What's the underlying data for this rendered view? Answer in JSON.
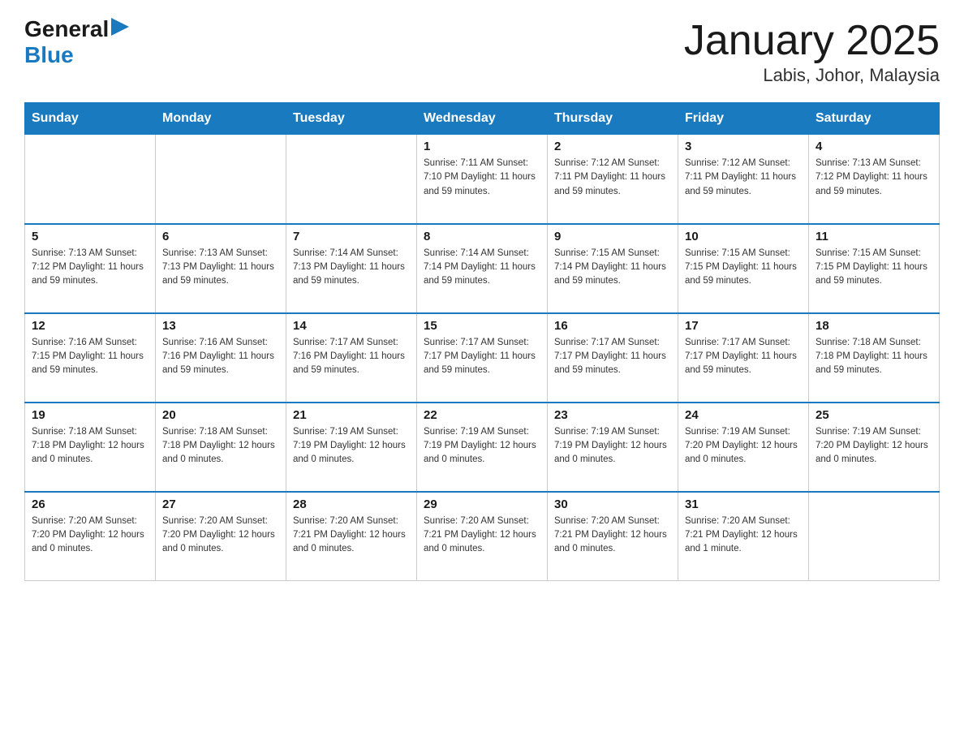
{
  "header": {
    "logo": {
      "general": "General",
      "blue": "Blue",
      "arrow": "▶"
    },
    "title": "January 2025",
    "subtitle": "Labis, Johor, Malaysia"
  },
  "days_of_week": [
    "Sunday",
    "Monday",
    "Tuesday",
    "Wednesday",
    "Thursday",
    "Friday",
    "Saturday"
  ],
  "weeks": [
    [
      {
        "day": "",
        "info": ""
      },
      {
        "day": "",
        "info": ""
      },
      {
        "day": "",
        "info": ""
      },
      {
        "day": "1",
        "info": "Sunrise: 7:11 AM\nSunset: 7:10 PM\nDaylight: 11 hours\nand 59 minutes."
      },
      {
        "day": "2",
        "info": "Sunrise: 7:12 AM\nSunset: 7:11 PM\nDaylight: 11 hours\nand 59 minutes."
      },
      {
        "day": "3",
        "info": "Sunrise: 7:12 AM\nSunset: 7:11 PM\nDaylight: 11 hours\nand 59 minutes."
      },
      {
        "day": "4",
        "info": "Sunrise: 7:13 AM\nSunset: 7:12 PM\nDaylight: 11 hours\nand 59 minutes."
      }
    ],
    [
      {
        "day": "5",
        "info": "Sunrise: 7:13 AM\nSunset: 7:12 PM\nDaylight: 11 hours\nand 59 minutes."
      },
      {
        "day": "6",
        "info": "Sunrise: 7:13 AM\nSunset: 7:13 PM\nDaylight: 11 hours\nand 59 minutes."
      },
      {
        "day": "7",
        "info": "Sunrise: 7:14 AM\nSunset: 7:13 PM\nDaylight: 11 hours\nand 59 minutes."
      },
      {
        "day": "8",
        "info": "Sunrise: 7:14 AM\nSunset: 7:14 PM\nDaylight: 11 hours\nand 59 minutes."
      },
      {
        "day": "9",
        "info": "Sunrise: 7:15 AM\nSunset: 7:14 PM\nDaylight: 11 hours\nand 59 minutes."
      },
      {
        "day": "10",
        "info": "Sunrise: 7:15 AM\nSunset: 7:15 PM\nDaylight: 11 hours\nand 59 minutes."
      },
      {
        "day": "11",
        "info": "Sunrise: 7:15 AM\nSunset: 7:15 PM\nDaylight: 11 hours\nand 59 minutes."
      }
    ],
    [
      {
        "day": "12",
        "info": "Sunrise: 7:16 AM\nSunset: 7:15 PM\nDaylight: 11 hours\nand 59 minutes."
      },
      {
        "day": "13",
        "info": "Sunrise: 7:16 AM\nSunset: 7:16 PM\nDaylight: 11 hours\nand 59 minutes."
      },
      {
        "day": "14",
        "info": "Sunrise: 7:17 AM\nSunset: 7:16 PM\nDaylight: 11 hours\nand 59 minutes."
      },
      {
        "day": "15",
        "info": "Sunrise: 7:17 AM\nSunset: 7:17 PM\nDaylight: 11 hours\nand 59 minutes."
      },
      {
        "day": "16",
        "info": "Sunrise: 7:17 AM\nSunset: 7:17 PM\nDaylight: 11 hours\nand 59 minutes."
      },
      {
        "day": "17",
        "info": "Sunrise: 7:17 AM\nSunset: 7:17 PM\nDaylight: 11 hours\nand 59 minutes."
      },
      {
        "day": "18",
        "info": "Sunrise: 7:18 AM\nSunset: 7:18 PM\nDaylight: 11 hours\nand 59 minutes."
      }
    ],
    [
      {
        "day": "19",
        "info": "Sunrise: 7:18 AM\nSunset: 7:18 PM\nDaylight: 12 hours\nand 0 minutes."
      },
      {
        "day": "20",
        "info": "Sunrise: 7:18 AM\nSunset: 7:18 PM\nDaylight: 12 hours\nand 0 minutes."
      },
      {
        "day": "21",
        "info": "Sunrise: 7:19 AM\nSunset: 7:19 PM\nDaylight: 12 hours\nand 0 minutes."
      },
      {
        "day": "22",
        "info": "Sunrise: 7:19 AM\nSunset: 7:19 PM\nDaylight: 12 hours\nand 0 minutes."
      },
      {
        "day": "23",
        "info": "Sunrise: 7:19 AM\nSunset: 7:19 PM\nDaylight: 12 hours\nand 0 minutes."
      },
      {
        "day": "24",
        "info": "Sunrise: 7:19 AM\nSunset: 7:20 PM\nDaylight: 12 hours\nand 0 minutes."
      },
      {
        "day": "25",
        "info": "Sunrise: 7:19 AM\nSunset: 7:20 PM\nDaylight: 12 hours\nand 0 minutes."
      }
    ],
    [
      {
        "day": "26",
        "info": "Sunrise: 7:20 AM\nSunset: 7:20 PM\nDaylight: 12 hours\nand 0 minutes."
      },
      {
        "day": "27",
        "info": "Sunrise: 7:20 AM\nSunset: 7:20 PM\nDaylight: 12 hours\nand 0 minutes."
      },
      {
        "day": "28",
        "info": "Sunrise: 7:20 AM\nSunset: 7:21 PM\nDaylight: 12 hours\nand 0 minutes."
      },
      {
        "day": "29",
        "info": "Sunrise: 7:20 AM\nSunset: 7:21 PM\nDaylight: 12 hours\nand 0 minutes."
      },
      {
        "day": "30",
        "info": "Sunrise: 7:20 AM\nSunset: 7:21 PM\nDaylight: 12 hours\nand 0 minutes."
      },
      {
        "day": "31",
        "info": "Sunrise: 7:20 AM\nSunset: 7:21 PM\nDaylight: 12 hours\nand 1 minute."
      },
      {
        "day": "",
        "info": ""
      }
    ]
  ]
}
